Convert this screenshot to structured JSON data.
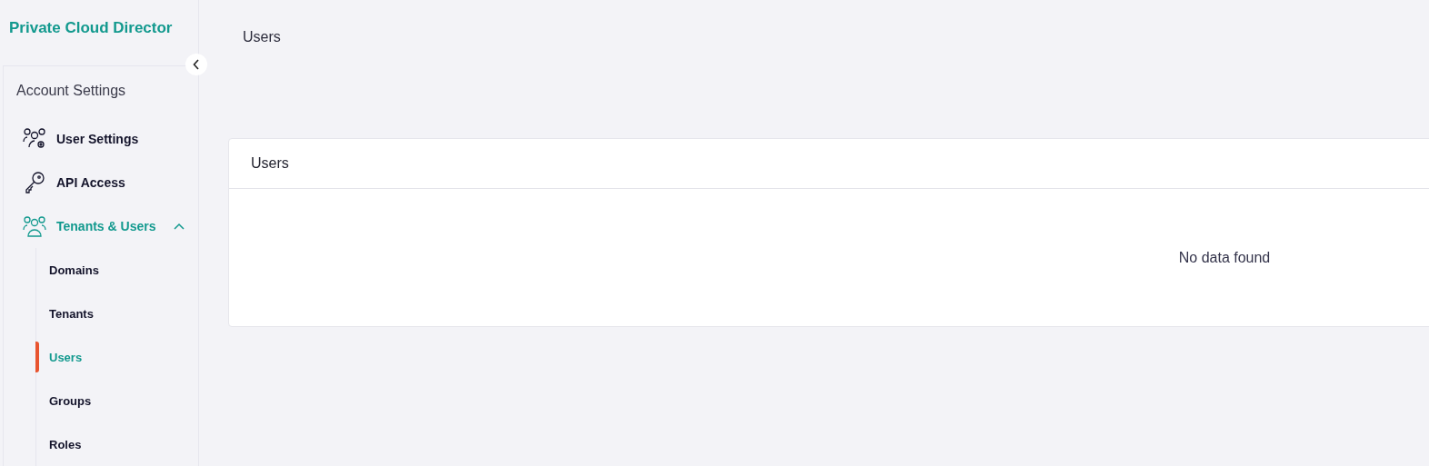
{
  "brand": "Private Cloud Director",
  "sidebar": {
    "title": "Account Settings",
    "items": [
      {
        "label": "User Settings",
        "selected": false
      },
      {
        "label": "API Access",
        "selected": false
      },
      {
        "label": "Tenants & Users",
        "selected": true,
        "expanded": true,
        "children": [
          {
            "label": "Domains",
            "selected": false
          },
          {
            "label": "Tenants",
            "selected": false
          },
          {
            "label": "Users",
            "selected": true
          },
          {
            "label": "Groups",
            "selected": false
          },
          {
            "label": "Roles",
            "selected": false
          }
        ]
      }
    ]
  },
  "breadcrumb": "Users",
  "card": {
    "title": "Users",
    "empty_message": "No data found"
  }
}
